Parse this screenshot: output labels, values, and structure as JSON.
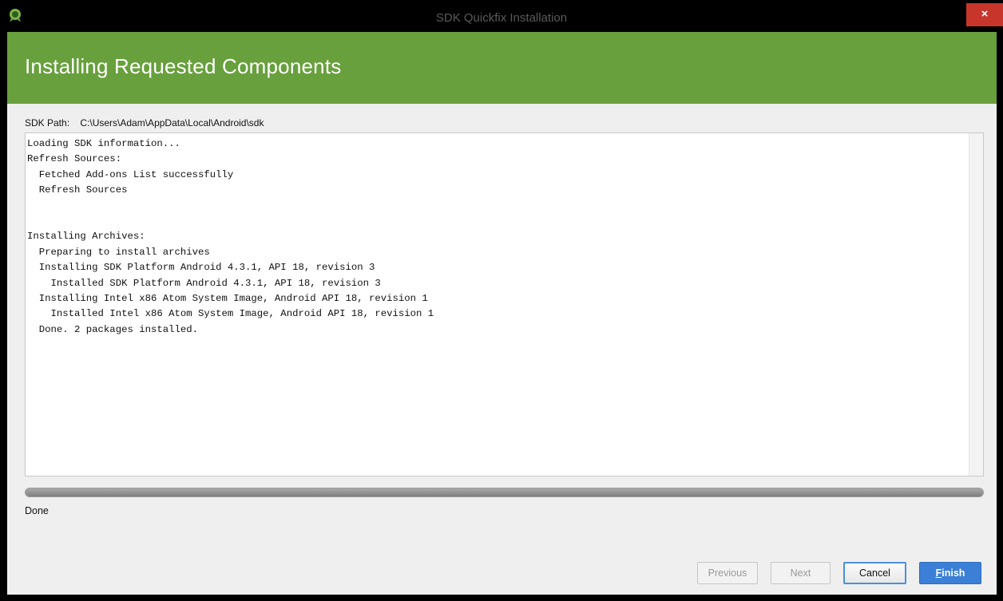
{
  "window": {
    "title": "SDK Quickfix Installation",
    "close_glyph": "×",
    "icon": "android-studio-icon"
  },
  "banner": {
    "title": "Installing Requested Components",
    "color": "#67a03c"
  },
  "sdk_path": {
    "label": "SDK Path:",
    "value": "C:\\Users\\Adam\\AppData\\Local\\Android\\sdk"
  },
  "log": {
    "lines": [
      "Loading SDK information...",
      "Refresh Sources:",
      "  Fetched Add-ons List successfully",
      "  Refresh Sources",
      "",
      "",
      "Installing Archives:",
      "  Preparing to install archives",
      "  Installing SDK Platform Android 4.3.1, API 18, revision 3",
      "    Installed SDK Platform Android 4.3.1, API 18, revision 3",
      "  Installing Intel x86 Atom System Image, Android API 18, revision 1",
      "    Installed Intel x86 Atom System Image, Android API 18, revision 1",
      "  Done. 2 packages installed."
    ]
  },
  "progress": {
    "fraction": 1.0
  },
  "status": {
    "text": "Done"
  },
  "buttons": {
    "previous": "Previous",
    "next": "Next",
    "cancel": "Cancel",
    "finish": "Finish"
  }
}
